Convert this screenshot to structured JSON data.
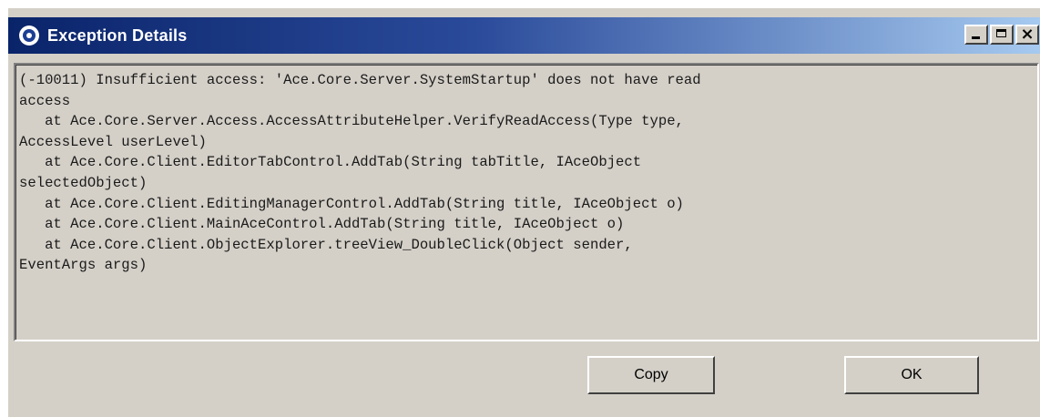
{
  "window": {
    "title": "Exception Details",
    "controls": {
      "minimize": "minimize",
      "maximize": "maximize",
      "close": "x"
    }
  },
  "message": {
    "lines": [
      "(-10011) Insufficient access: 'Ace.Core.Server.SystemStartup' does not have read",
      "access",
      "   at Ace.Core.Server.Access.AccessAttributeHelper.VerifyReadAccess(Type type,",
      "AccessLevel userLevel)",
      "   at Ace.Core.Client.EditorTabControl.AddTab(String tabTitle, IAceObject",
      "selectedObject)",
      "   at Ace.Core.Client.EditingManagerControl.AddTab(String title, IAceObject o)",
      "   at Ace.Core.Client.MainAceControl.AddTab(String title, IAceObject o)",
      "   at Ace.Core.Client.ObjectExplorer.treeView_DoubleClick(Object sender,",
      "EventArgs args)"
    ]
  },
  "buttons": {
    "copy_label": "Copy",
    "ok_label": "OK"
  },
  "colors": {
    "titlebar_start": "#0a246a",
    "titlebar_end": "#a6caf0",
    "face": "#d4d0c8"
  }
}
